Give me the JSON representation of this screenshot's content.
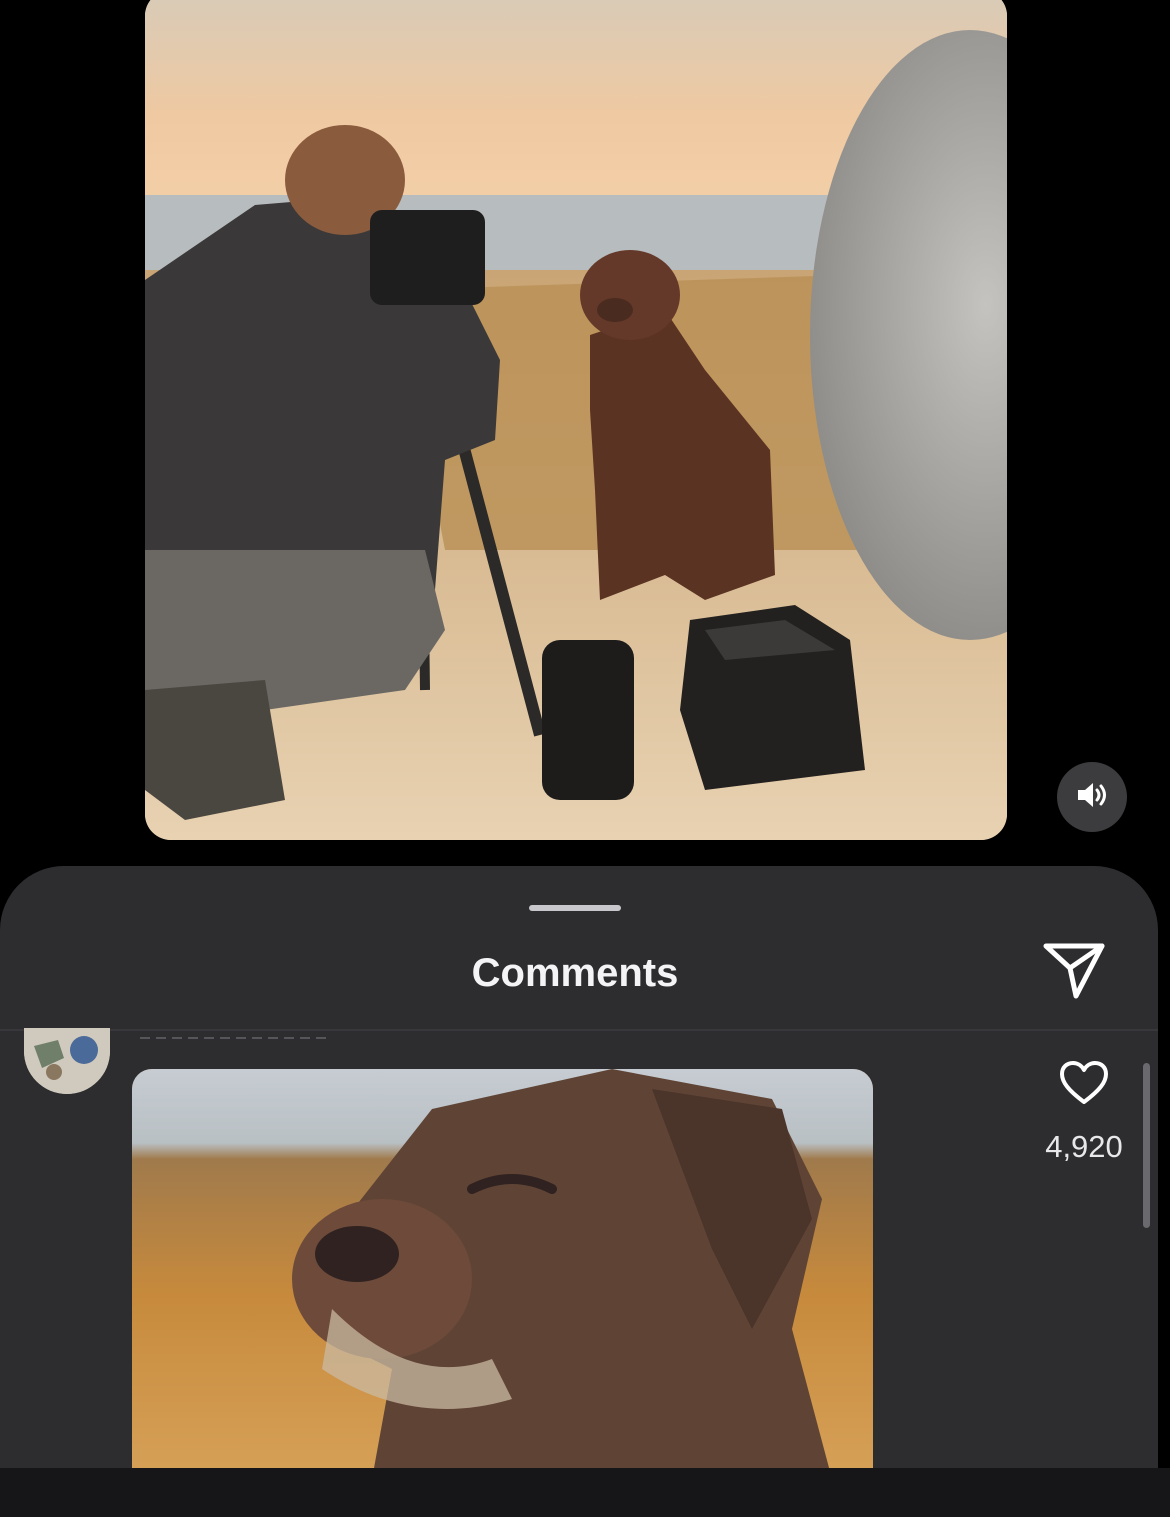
{
  "video": {
    "image_description": "photo"
  },
  "comments_sheet": {
    "title": "Comments"
  },
  "comment": {
    "like_count": "4,920"
  },
  "colors": {
    "sheet_background": "#2d2d30",
    "page_background": "#000000",
    "text_primary": "#f4f4f6"
  },
  "icons": {
    "volume": "speaker-volume-icon",
    "send": "paper-plane-icon",
    "like": "heart-outline-icon"
  }
}
